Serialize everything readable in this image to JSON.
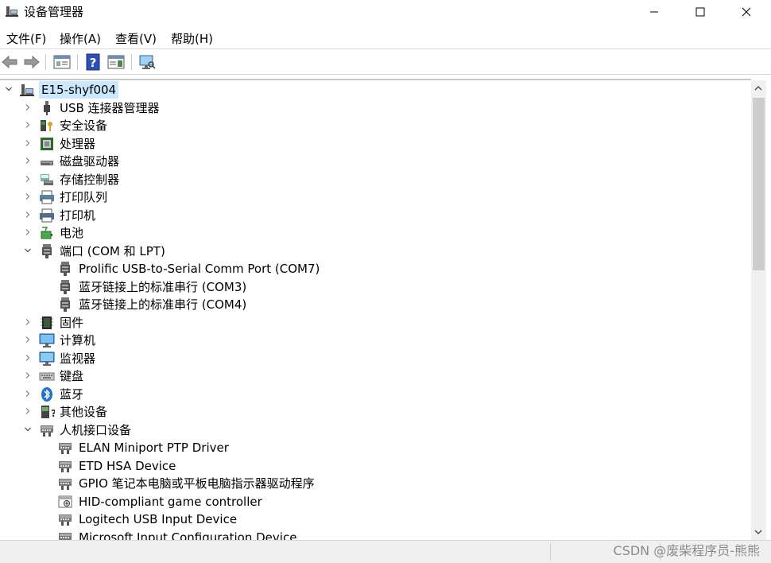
{
  "window": {
    "title": "设备管理器",
    "icon": "device-manager-icon"
  },
  "menu": [
    "文件(F)",
    "操作(A)",
    "查看(V)",
    "帮助(H)"
  ],
  "toolbar": [
    "back-arrow-icon",
    "forward-arrow-icon",
    "properties-icon",
    "help-icon",
    "view-icon",
    "monitor-scan-icon"
  ],
  "tree": {
    "root": "E15-shyf004",
    "items": [
      {
        "label": "USB 连接器管理器",
        "level": 1,
        "expanded": false,
        "icon": "usb-icon"
      },
      {
        "label": "安全设备",
        "level": 1,
        "expanded": false,
        "icon": "security-key-icon"
      },
      {
        "label": "处理器",
        "level": 1,
        "expanded": false,
        "icon": "processor-icon"
      },
      {
        "label": "磁盘驱动器",
        "level": 1,
        "expanded": false,
        "icon": "disk-drive-icon"
      },
      {
        "label": "存储控制器",
        "level": 1,
        "expanded": false,
        "icon": "storage-controller-icon"
      },
      {
        "label": "打印队列",
        "level": 1,
        "expanded": false,
        "icon": "print-queue-icon"
      },
      {
        "label": "打印机",
        "level": 1,
        "expanded": false,
        "icon": "printer-icon"
      },
      {
        "label": "电池",
        "level": 1,
        "expanded": false,
        "icon": "battery-icon"
      },
      {
        "label": "端口 (COM 和 LPT)",
        "level": 1,
        "expanded": true,
        "icon": "port-icon"
      },
      {
        "label": "Prolific USB-to-Serial Comm Port (COM7)",
        "level": 2,
        "icon": "port-icon"
      },
      {
        "label": "蓝牙链接上的标准串行 (COM3)",
        "level": 2,
        "icon": "port-icon"
      },
      {
        "label": "蓝牙链接上的标准串行 (COM4)",
        "level": 2,
        "icon": "port-icon"
      },
      {
        "label": "固件",
        "level": 1,
        "expanded": false,
        "icon": "firmware-icon"
      },
      {
        "label": "计算机",
        "level": 1,
        "expanded": false,
        "icon": "computer-icon"
      },
      {
        "label": "监视器",
        "level": 1,
        "expanded": false,
        "icon": "monitor-icon"
      },
      {
        "label": "键盘",
        "level": 1,
        "expanded": false,
        "icon": "keyboard-icon"
      },
      {
        "label": "蓝牙",
        "level": 1,
        "expanded": false,
        "icon": "bluetooth-icon"
      },
      {
        "label": "其他设备",
        "level": 1,
        "expanded": false,
        "icon": "other-devices-icon"
      },
      {
        "label": "人机接口设备",
        "level": 1,
        "expanded": true,
        "icon": "hid-icon"
      },
      {
        "label": "ELAN Miniport PTP Driver",
        "level": 2,
        "icon": "hid-icon"
      },
      {
        "label": "ETD HSA Device",
        "level": 2,
        "icon": "hid-icon"
      },
      {
        "label": "GPIO 笔记本电脑或平板电脑指示器驱动程序",
        "level": 2,
        "icon": "hid-icon"
      },
      {
        "label": "HID-compliant game controller",
        "level": 2,
        "icon": "game-controller-icon"
      },
      {
        "label": "Logitech USB Input Device",
        "level": 2,
        "icon": "hid-icon"
      },
      {
        "label": "Microsoft Input Configuration Device",
        "level": 2,
        "icon": "hid-icon"
      }
    ]
  },
  "watermark": "CSDN @废柴程序员-熊熊",
  "colors": {
    "selection": "#cce8ff",
    "accent_blue": "#1e73c8",
    "scrollbar_thumb": "#cdcdcd"
  }
}
